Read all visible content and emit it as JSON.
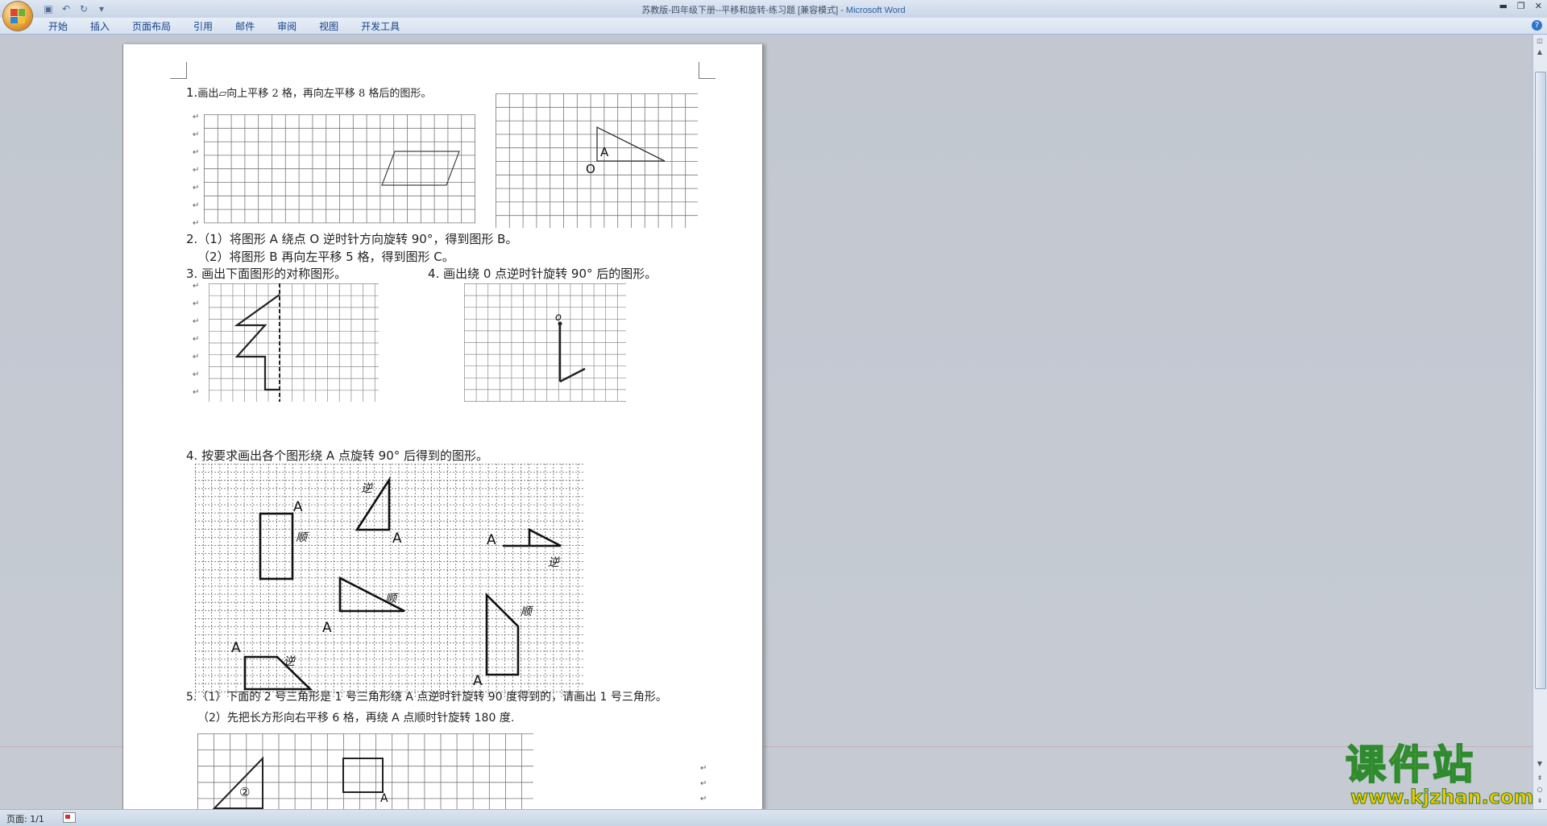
{
  "window": {
    "title_doc": "苏教版-四年级下册--平移和旋转-练习题 [兼容模式] - ",
    "title_app": "Microsoft Word"
  },
  "ribbon": {
    "tabs": [
      "开始",
      "插入",
      "页面布局",
      "引用",
      "邮件",
      "审阅",
      "视图",
      "开发工具"
    ]
  },
  "document": {
    "q1": "1.",
    "q1_text": "画出▱向上平移 2 格，再向左平移 8 格后的图形。",
    "q2_line1": "2.（1）将图形 A 绕点 O 逆时针方向旋转 90°，得到图形 B。",
    "q2_line2": "（2）将图形 B 再向左平移 5 格，得到图形 C。",
    "q3": "3. 画出下面图形的对称图形。",
    "q4a": "4. 画出绕 0 点逆时针旋转 90° 后的图形。",
    "q4b": "4. 按要求画出各个图形绕 A 点旋转 90° 后得到的图形。",
    "q5_line1": "5.（1）下面的 2 号三角形是 1 号三角形绕 A 点逆时针旋转 90 度得到的，请画出 1 号三角形。",
    "q5_line2": "（2）先把长方形向右平移 6 格，再绕 A 点顺时针旋转 180 度.",
    "label_A": "A",
    "label_O": "O",
    "label_o_lower": "o",
    "label_ni": "逆",
    "label_shun": "顺",
    "label_2": "②",
    "para_mark": "↵"
  },
  "status": {
    "page": "页面: 1/1"
  },
  "watermark": {
    "title": "课件站",
    "url": "www.kjzhan.com"
  }
}
